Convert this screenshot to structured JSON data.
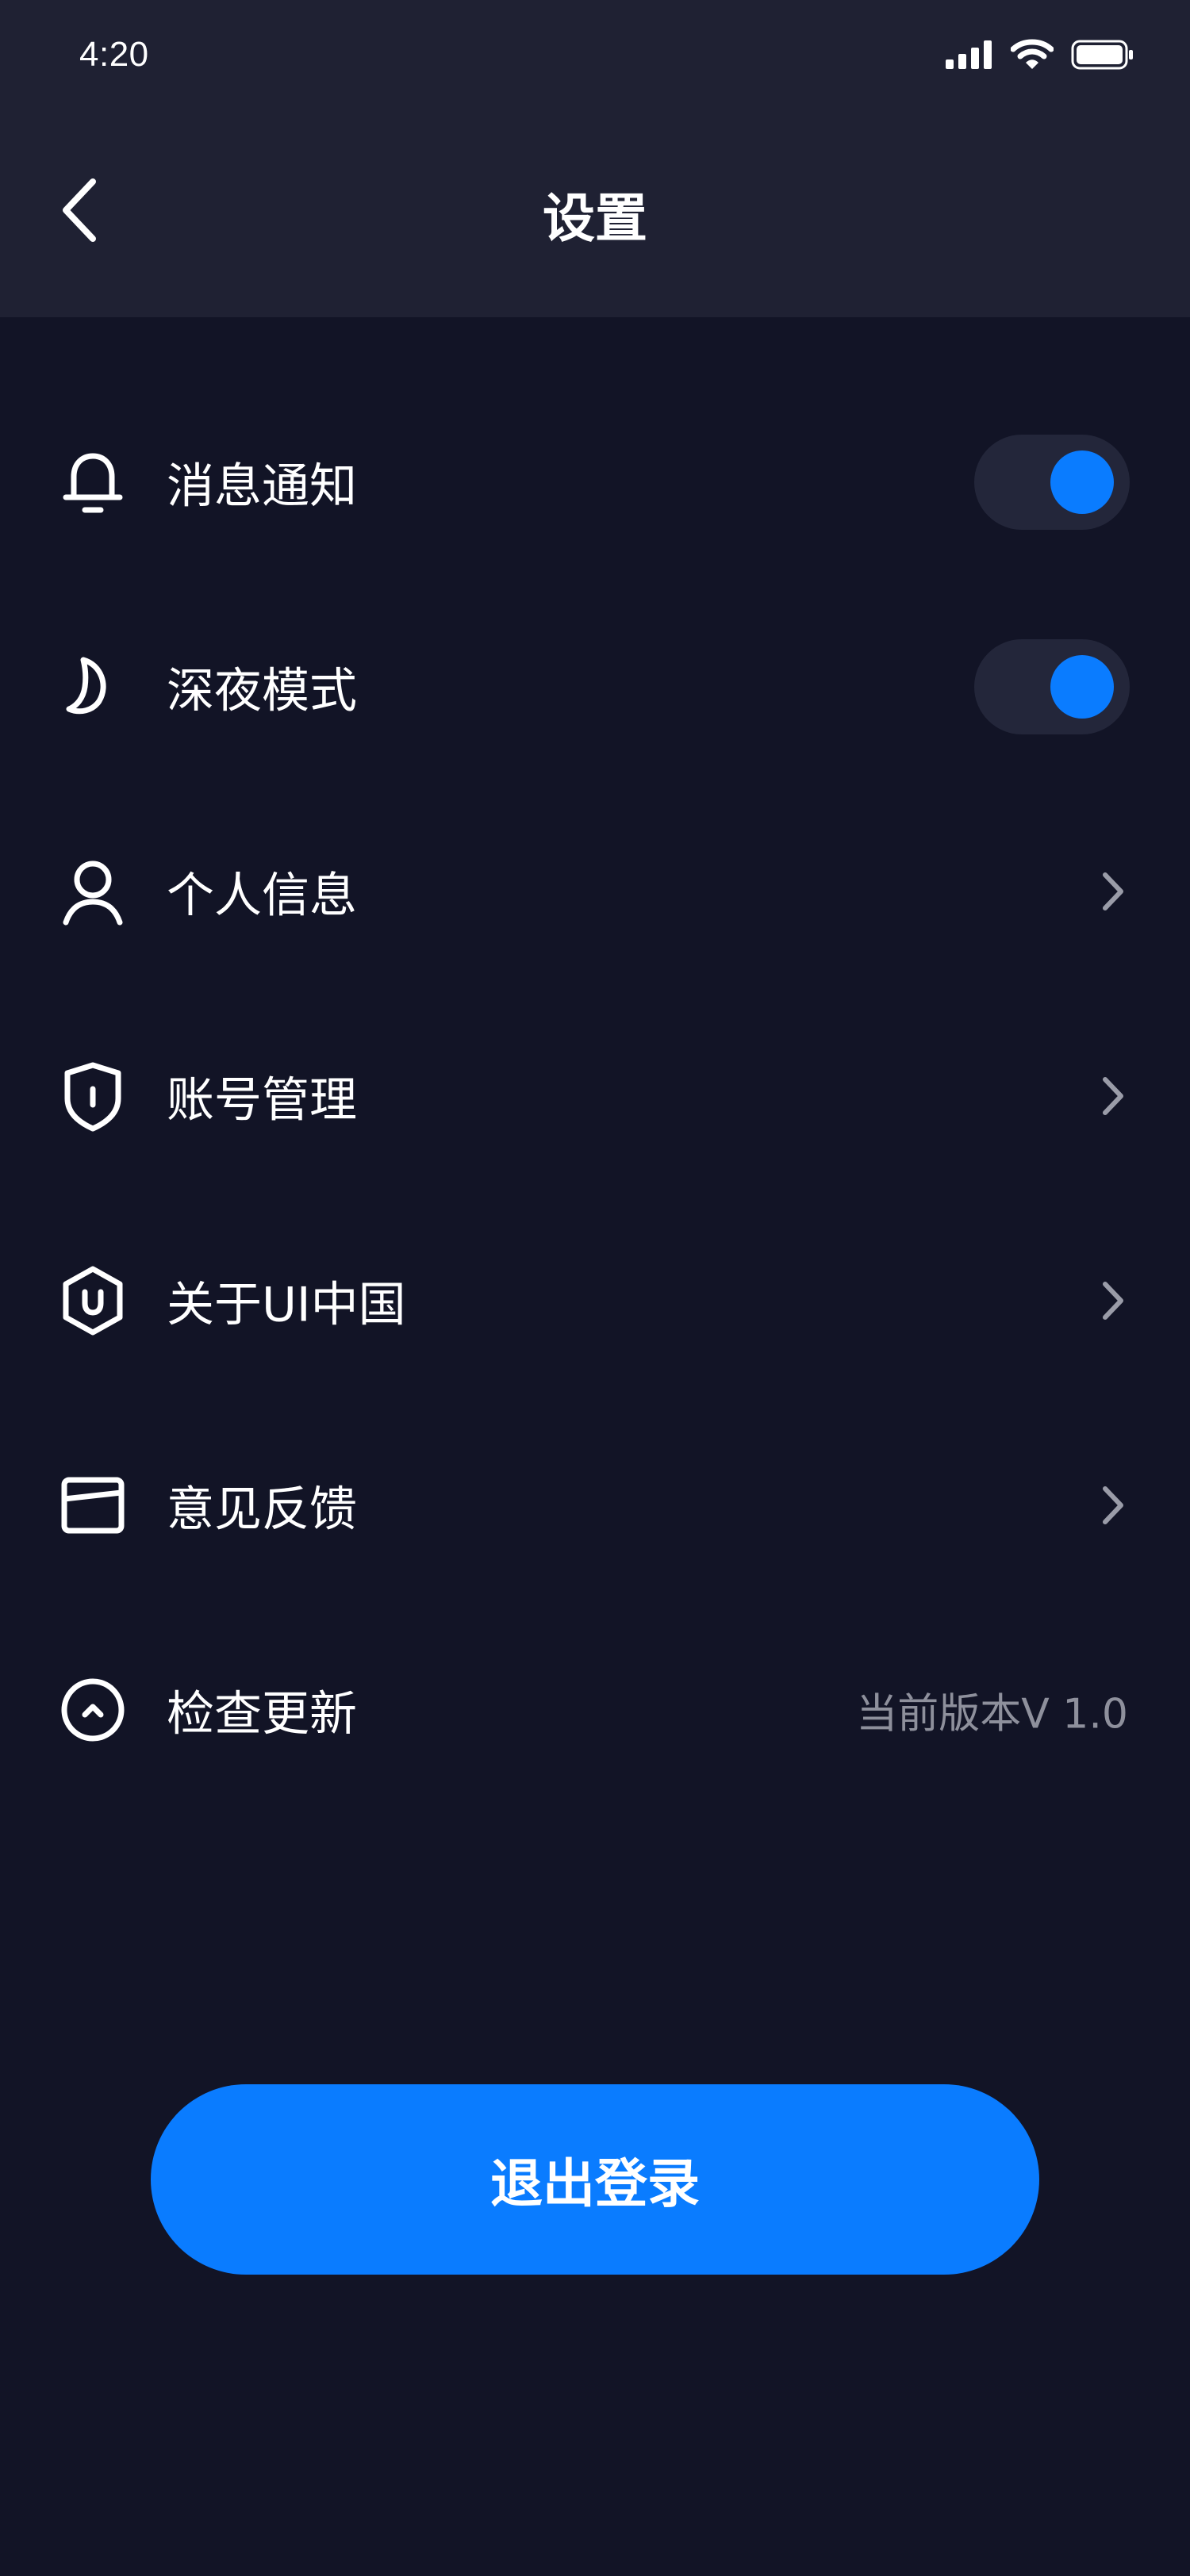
{
  "status_bar": {
    "time": "4:20",
    "signal_icon": "signal-icon",
    "wifi_icon": "wifi-icon",
    "battery_icon": "battery-icon"
  },
  "header": {
    "back_icon": "chevron-left-icon",
    "title": "设置"
  },
  "settings": {
    "items": [
      {
        "icon": "bell-icon",
        "label": "消息通知",
        "control": "toggle",
        "on": true
      },
      {
        "icon": "moon-icon",
        "label": "深夜模式",
        "control": "toggle",
        "on": true
      },
      {
        "icon": "user-icon",
        "label": "个人信息",
        "control": "chevron"
      },
      {
        "icon": "shield-icon",
        "label": "账号管理",
        "control": "chevron"
      },
      {
        "icon": "hexagon-u-icon",
        "label": "关于UI中国",
        "control": "chevron"
      },
      {
        "icon": "card-icon",
        "label": "意见反馈",
        "control": "chevron"
      },
      {
        "icon": "arrow-up-circle-icon",
        "label": "检查更新",
        "control": "value",
        "value": "当前版本V 1.0"
      }
    ]
  },
  "logout": {
    "label": "退出登录"
  },
  "colors": {
    "background": "#121426",
    "header": "#1F2133",
    "accent": "#0A7CFF",
    "toggle_track": "#23263A",
    "secondary_text": "#8E909C"
  }
}
